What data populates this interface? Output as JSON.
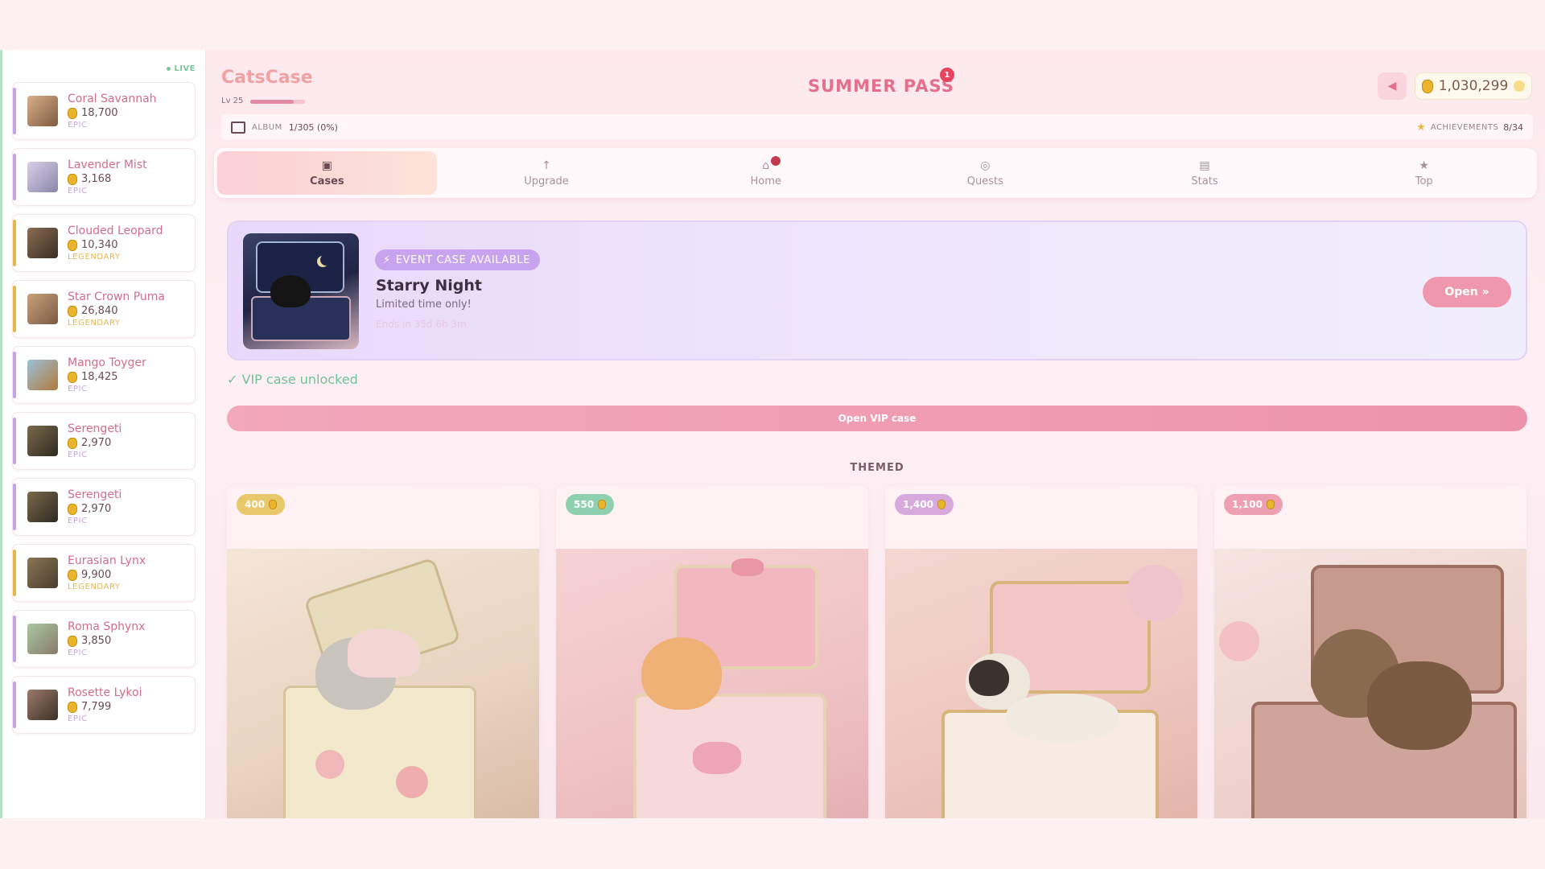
{
  "sidebar": {
    "live_label": "LIVE",
    "feed": [
      {
        "name": "Coral Savannah",
        "price": "18,700",
        "rarity": "EPIC"
      },
      {
        "name": "Lavender Mist",
        "price": "3,168",
        "rarity": "EPIC"
      },
      {
        "name": "Clouded Leopard",
        "price": "10,340",
        "rarity": "LEGENDARY"
      },
      {
        "name": "Star Crown Puma",
        "price": "26,840",
        "rarity": "LEGENDARY"
      },
      {
        "name": "Mango Toyger",
        "price": "18,425",
        "rarity": "EPIC"
      },
      {
        "name": "Serengeti",
        "price": "2,970",
        "rarity": "EPIC"
      },
      {
        "name": "Serengeti",
        "price": "2,970",
        "rarity": "EPIC"
      },
      {
        "name": "Eurasian Lynx",
        "price": "9,900",
        "rarity": "LEGENDARY"
      },
      {
        "name": "Roma Sphynx",
        "price": "3,850",
        "rarity": "EPIC"
      },
      {
        "name": "Rosette Lykoi",
        "price": "7,799",
        "rarity": "EPIC"
      }
    ]
  },
  "header": {
    "brand": "CatsCase",
    "level": "Lv 25",
    "level_progress": 0.8,
    "pass_title": "SUMMER PASS",
    "pass_badge": "1",
    "balance": "1,030,299",
    "album_label": "ALBUM",
    "album_value": "1/305 (0%)",
    "achievements_label": "ACHIEVEMENTS",
    "achievements_value": "8/34"
  },
  "tabs": [
    {
      "label": "Cases",
      "icon": "cases-icon"
    },
    {
      "label": "Upgrade",
      "icon": "upgrade-icon"
    },
    {
      "label": "Home",
      "icon": "home-icon"
    },
    {
      "label": "Quests",
      "icon": "quests-icon"
    },
    {
      "label": "Stats",
      "icon": "stats-icon"
    },
    {
      "label": "Top",
      "icon": "top-icon"
    }
  ],
  "event": {
    "tag": "EVENT CASE AVAILABLE",
    "title": "Starry Night",
    "subtitle": "Limited time only!",
    "ends": "Ends in 35d 6h 3m",
    "open_label": "Open »"
  },
  "vip": {
    "message": "✓ VIP case unlocked",
    "button": "Open VIP case"
  },
  "themed": {
    "title": "THEMED",
    "cards": [
      {
        "price": "400",
        "color": "#e8c86a"
      },
      {
        "price": "550",
        "color": "#8fd0b0"
      },
      {
        "price": "1,400",
        "color": "#d7a9dc"
      },
      {
        "price": "1,100",
        "color": "#ee9fb2"
      }
    ]
  },
  "colors": {
    "accent": "#e56e8d",
    "epic": "#c8a2e0",
    "legendary": "#e6b84a",
    "live": "#7cc79a"
  }
}
